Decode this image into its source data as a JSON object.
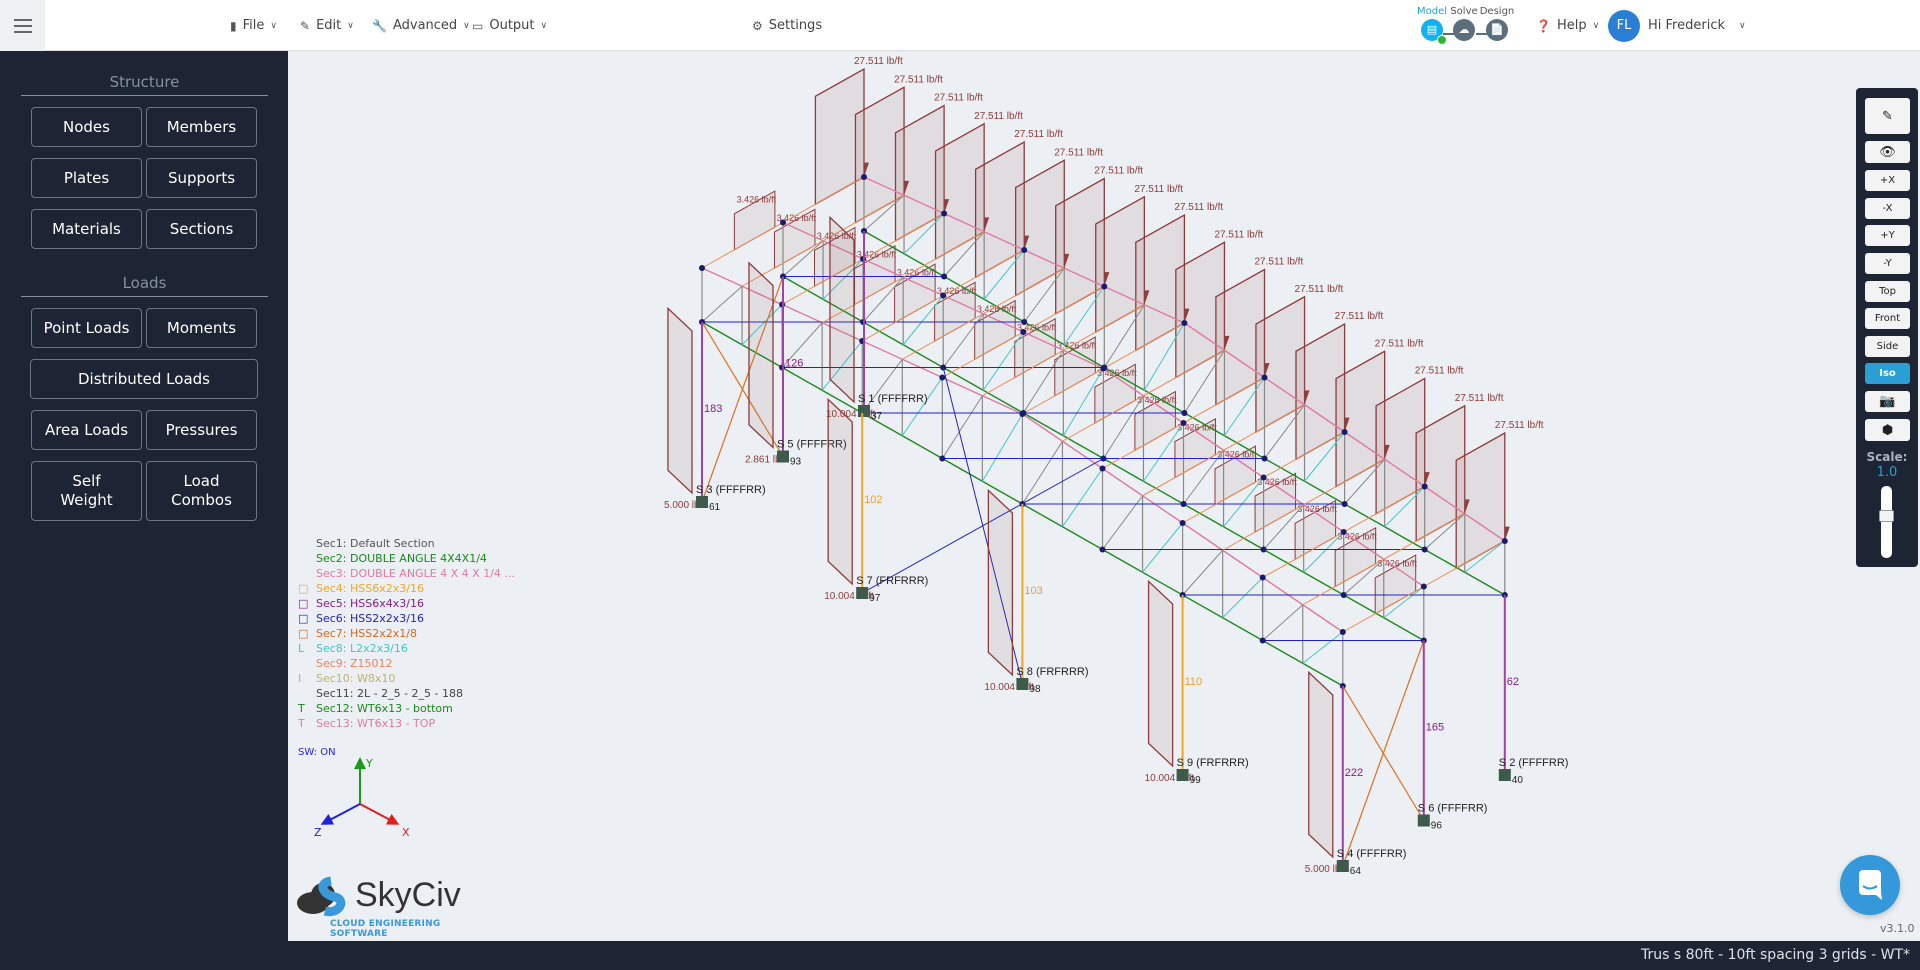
{
  "header": {
    "menu": [
      {
        "label": "File",
        "icon": "file-icon"
      },
      {
        "label": "Edit",
        "icon": "pencil-icon"
      },
      {
        "label": "Advanced",
        "icon": "wrench-icon"
      },
      {
        "label": "Output",
        "icon": "monitor-icon"
      },
      {
        "label": "Settings",
        "icon": "gear-icon"
      }
    ],
    "steps": [
      {
        "label": "Model",
        "active": true
      },
      {
        "label": "Solve",
        "active": false
      },
      {
        "label": "Design",
        "active": false
      }
    ],
    "help": "Help",
    "user_initials": "FL",
    "user_greeting": "Hi Frederick"
  },
  "sidebar": {
    "structure_title": "Structure",
    "structure_buttons": [
      "Nodes",
      "Members",
      "Plates",
      "Supports",
      "Materials",
      "Sections"
    ],
    "loads_title": "Loads",
    "loads_buttons": [
      "Point Loads",
      "Moments",
      "Distributed Loads",
      "Area Loads",
      "Pressures",
      "Self Weight",
      "Load Combos"
    ]
  },
  "legend": {
    "sections": [
      {
        "label": "Sec1: Default Section",
        "color": "#555555",
        "icon": ""
      },
      {
        "label": "Sec2: DOUBLE ANGLE 4X4X1/4",
        "color": "#1a8a1a",
        "icon": ""
      },
      {
        "label": "Sec3: DOUBLE ANGLE 4 X 4 X 1/4 ...",
        "color": "#e07aa0",
        "icon": ""
      },
      {
        "label": "Sec4: HSS6x2x3/16",
        "color": "#f5a623",
        "icon": "□"
      },
      {
        "label": "Sec5: HSS6x4x3/16",
        "color": "#8b1a8b",
        "icon": "□"
      },
      {
        "label": "Sec6: HSS2x2x3/16",
        "color": "#2222cc",
        "icon": "□"
      },
      {
        "label": "Sec7: HSS2x2x1/8",
        "color": "#d2691e",
        "icon": "□"
      },
      {
        "label": "Sec8: L2x2x3/16",
        "color": "#40c8c8",
        "icon": "L"
      },
      {
        "label": "Sec9: Z15012",
        "color": "#f08060",
        "icon": ""
      },
      {
        "label": "Sec10: W8x10",
        "color": "#c0b070",
        "icon": "I"
      },
      {
        "label": "Sec11: 2L - 2_5 - 2_5 - 188",
        "color": "#444444",
        "icon": ""
      },
      {
        "label": "Sec12: WT6x13 - bottom",
        "color": "#1a8a1a",
        "icon": "T"
      },
      {
        "label": "Sec13: WT6x13 - TOP",
        "color": "#e07aa0",
        "icon": "T"
      }
    ],
    "self_weight": "SW: ON"
  },
  "model": {
    "roof_load": "27.511 lb/ft",
    "purlin_load": "3.426 lb/ft",
    "supports": [
      {
        "label": "S 3 (FFFFRR)",
        "node": "61",
        "member": "183",
        "load": "5.000 lb/ft"
      },
      {
        "label": "S 5 (FFFFRR)",
        "node": "93",
        "member": "126",
        "load": "2.861 lb/ft"
      },
      {
        "label": "S 1 (FFFFRR)",
        "node": "37",
        "member": "",
        "load": "10.004 lb/ft"
      },
      {
        "label": "S 7 (FRFRRR)",
        "node": "97",
        "member": "102",
        "load": "10.004 lb/ft"
      },
      {
        "label": "S 8 (FRFRRR)",
        "node": "98",
        "member": "103",
        "load": "10.004 lb/ft"
      },
      {
        "label": "S 9 (FRFRRR)",
        "node": "99",
        "member": "110",
        "load": "10.004 lb/ft"
      },
      {
        "label": "S 4 (FFFFRR)",
        "node": "64",
        "member": "222",
        "load": "5.000 lb/ft"
      },
      {
        "label": "S 6 (FFFFRR)",
        "node": "96",
        "member": "165",
        "load": ""
      },
      {
        "label": "S 2 (FFFFRR)",
        "node": "40",
        "member": "62",
        "load": ""
      }
    ],
    "colors": {
      "load": "#8e3b3b",
      "bottom_chord": "#1a8a1a",
      "top_chord": "#e07aa0",
      "web": "#888888",
      "bracing": "#2222cc",
      "column": "#a040a8",
      "column_alt": "#f5a623",
      "purlin": "#f08a50",
      "node": "#1a1a6e",
      "support": "#3d5a4a"
    }
  },
  "axes": {
    "x": "X",
    "y": "Y",
    "z": "Z"
  },
  "logo": {
    "name": "SkyCiv",
    "tagline": "CLOUD ENGINEERING SOFTWARE"
  },
  "toolbar": {
    "buttons": [
      {
        "label": "",
        "icon": "pencil-icon"
      },
      {
        "label": "",
        "icon": "eye-icon"
      },
      {
        "label": "+X"
      },
      {
        "label": "-X"
      },
      {
        "label": "+Y"
      },
      {
        "label": "-Y"
      },
      {
        "label": "Top"
      },
      {
        "label": "Front"
      },
      {
        "label": "Side"
      },
      {
        "label": "Iso",
        "active": true
      },
      {
        "label": "",
        "icon": "camera-icon"
      },
      {
        "label": "",
        "icon": "cube-icon"
      }
    ],
    "scale_label": "Scale:",
    "scale_value": "1.0",
    "scale_slider": 0.5
  },
  "version": "v3.1.0",
  "footer": {
    "project_name": "Trus s 80ft - 10ft spacing 3 grids - WT*"
  }
}
